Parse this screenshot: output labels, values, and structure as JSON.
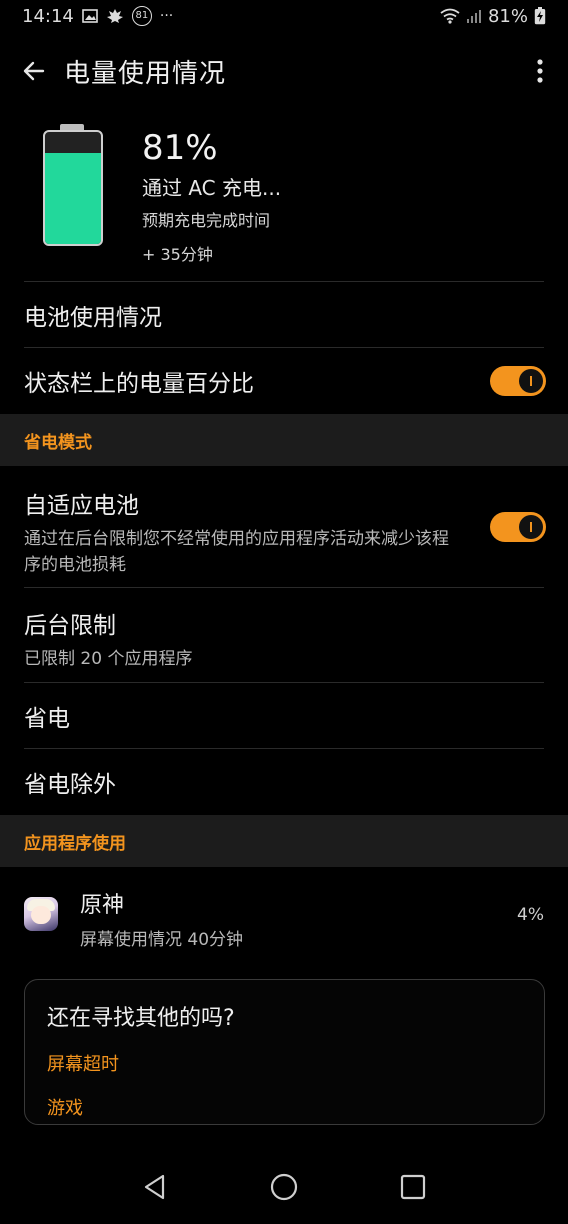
{
  "status_bar": {
    "time": "14:14",
    "badge": "81",
    "more": "···",
    "battery_percent": "81%"
  },
  "header": {
    "title": "电量使用情况"
  },
  "battery": {
    "percent": "81%",
    "level": 0.81,
    "status": "通过 AC 充电...",
    "eta_label": "预期充电完成时间",
    "eta_value": "+ 35分钟",
    "fill_color": "#22d89b"
  },
  "rows": {
    "battery_usage": "电池使用情况",
    "statusbar_percent": "状态栏上的电量百分比",
    "statusbar_percent_enabled": true
  },
  "power_saving": {
    "section_title": "省电模式",
    "adaptive_title": "自适应电池",
    "adaptive_desc": "通过在后台限制您不经常使用的应用程序活动来减少该程序的电池损耗",
    "adaptive_enabled": true,
    "bg_restrict_title": "后台限制",
    "bg_restrict_sub": "已限制 20 个应用程序",
    "power_save": "省电",
    "power_save_exempt": "省电除外"
  },
  "app_usage": {
    "section_title": "应用程序使用",
    "apps": [
      {
        "name": "原神",
        "sub": "屏幕使用情况 40分钟",
        "percent": "4%"
      }
    ]
  },
  "card": {
    "title": "还在寻找其他的吗?",
    "links": [
      "屏幕超时",
      "游戏"
    ]
  },
  "colors": {
    "accent": "#f3941e",
    "background": "#000000",
    "section_bg": "#1c1c1c"
  },
  "icons": {
    "back": "arrow-left-icon",
    "more": "more-vertical-icon",
    "nav_back": "triangle-back-icon",
    "nav_home": "circle-home-icon",
    "nav_recent": "square-recent-icon"
  }
}
